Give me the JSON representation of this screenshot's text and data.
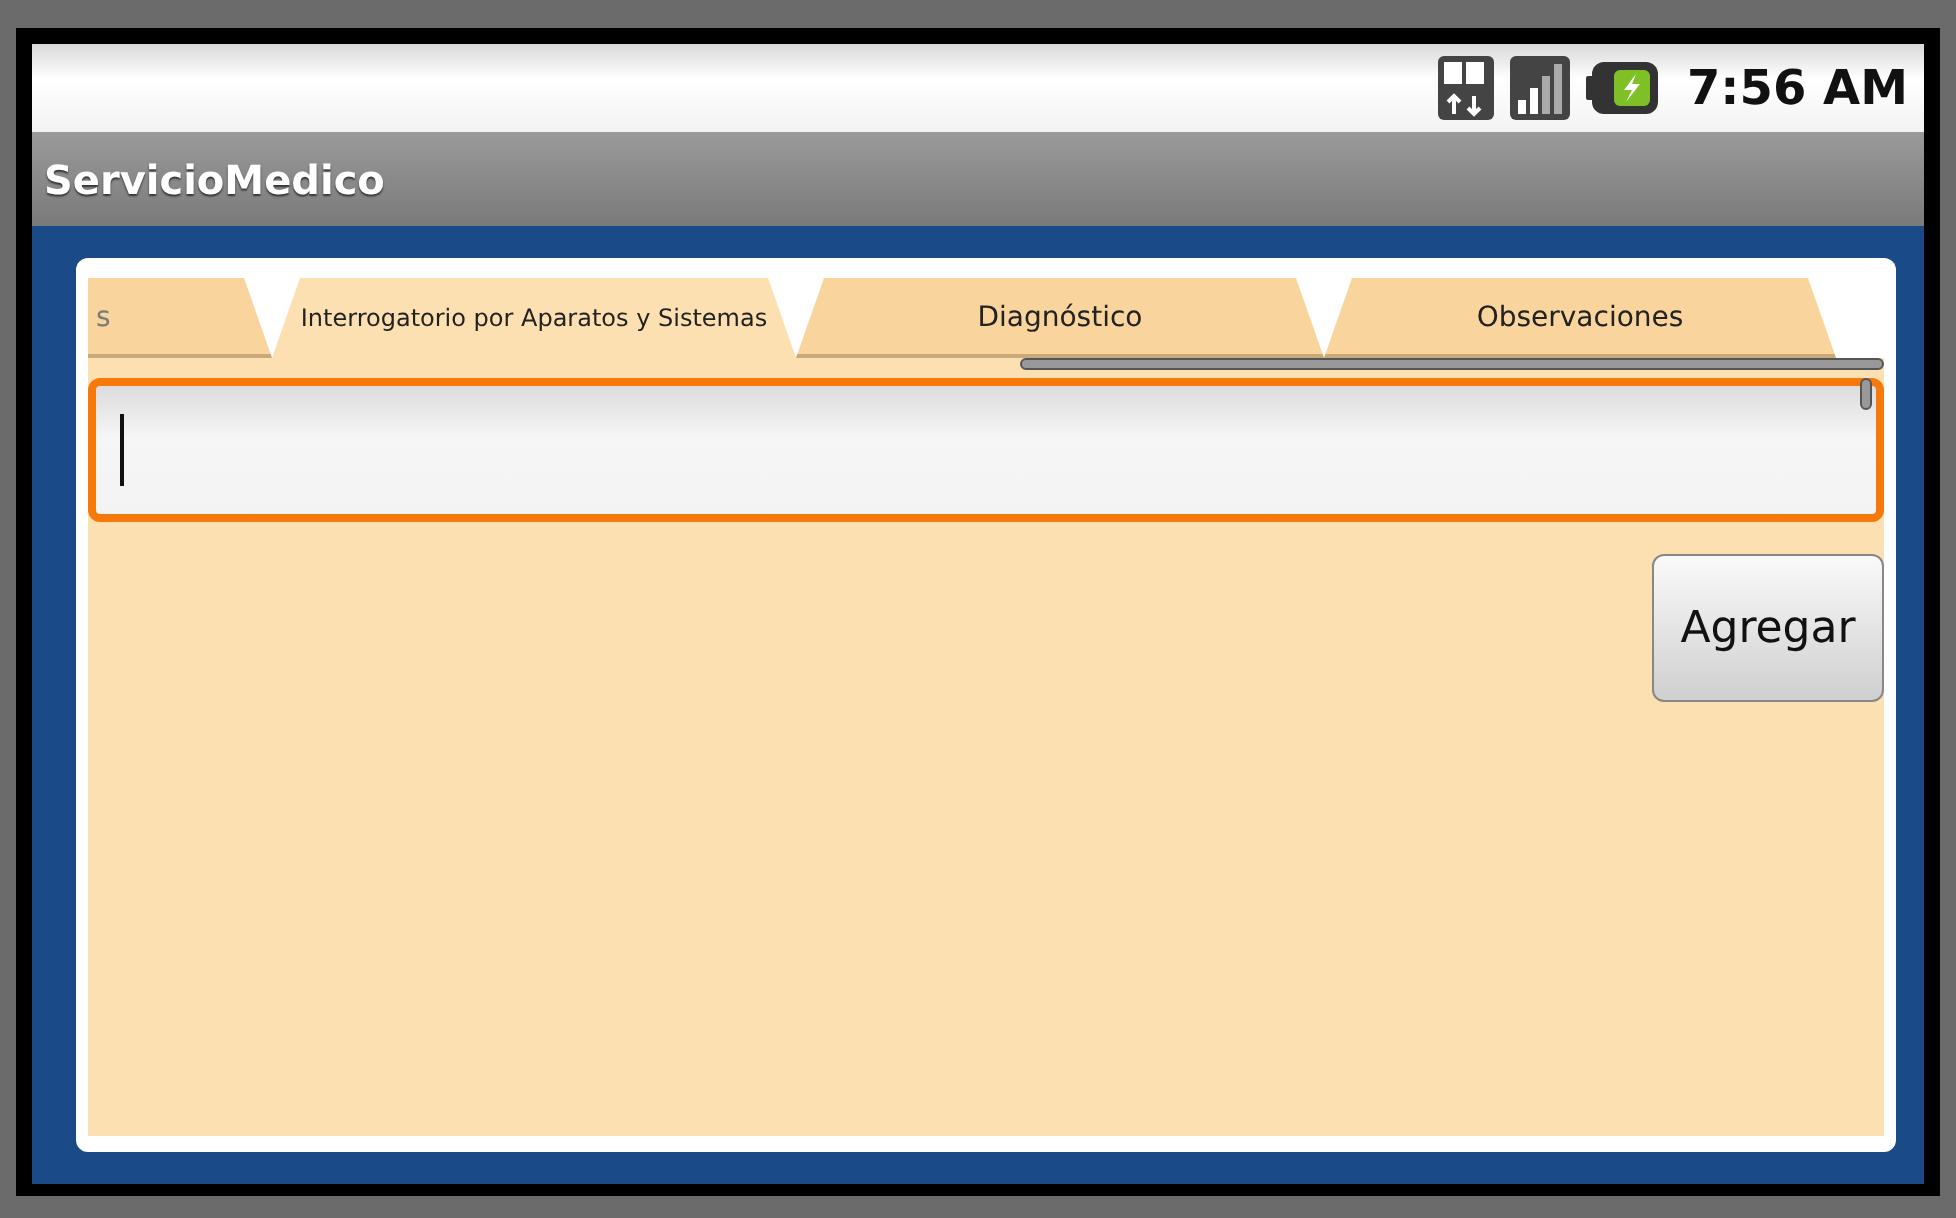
{
  "status_bar": {
    "time": "7:56 AM"
  },
  "app_bar": {
    "title": "ServicioMedico"
  },
  "tabs": [
    {
      "label": "s",
      "selected": false,
      "faded": true
    },
    {
      "label": "Interrogatorio por Aparatos y Sistemas",
      "selected": true,
      "faded": false
    },
    {
      "label": "Diagnóstico",
      "selected": false,
      "faded": false
    },
    {
      "label": "Observaciones",
      "selected": false,
      "faded": false
    }
  ],
  "input": {
    "focused": true
  },
  "buttons": [
    {
      "label": "Agregar"
    }
  ]
}
